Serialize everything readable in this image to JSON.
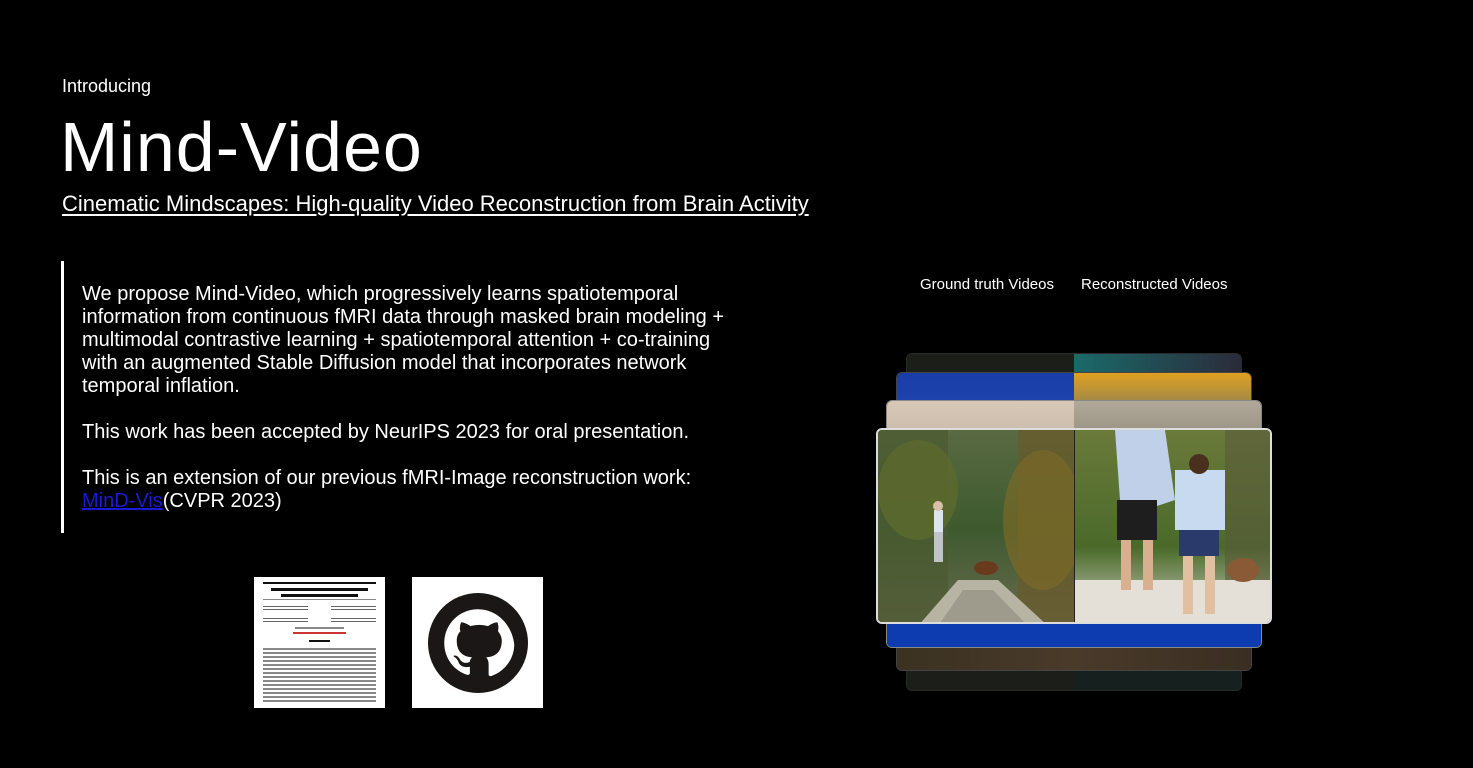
{
  "header": {
    "intro": "Introducing",
    "title": "Mind-Video",
    "paper_link": "Cinematic Mindscapes: High-quality Video Reconstruction from Brain Activity"
  },
  "abstract": {
    "paragraph1": "We propose Mind-Video, which progressively learns spatiotemporal information from continuous fMRI data through masked brain modeling + multimodal contrastive learning + spatiotemporal attention + co-training with an augmented Stable Diffusion model that incorporates network temporal inflation.",
    "paragraph2": "This work has been accepted by NeurIPS 2023 for oral presentation.",
    "paragraph3_prefix": "This is an extension of our previous fMRI-Image reconstruction work:",
    "mindvis_link": "MinD-Vis",
    "paragraph3_suffix": "(CVPR 2023)"
  },
  "links": {
    "paper_thumb": {
      "title": "Cinematic Mindscapes: High-quality Video Reconstruction from Brain Activity",
      "abstract_heading": "Abstract"
    },
    "github_icon": "github-icon"
  },
  "gallery": {
    "ground_truth_label": "Ground truth Videos",
    "reconstructed_label": "Reconstructed Videos"
  },
  "colors": {
    "background": "#000000",
    "text": "#ffffff",
    "link": "#1a1ad8"
  }
}
